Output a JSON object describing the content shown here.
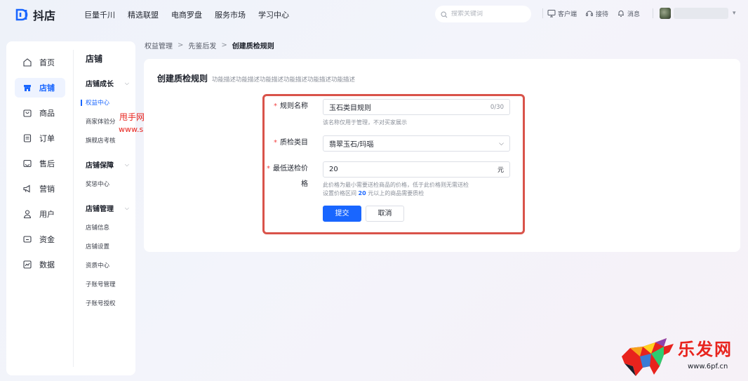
{
  "app": {
    "name": "抖店",
    "brand_color": "#1966ff"
  },
  "topnav": [
    "巨量千川",
    "精选联盟",
    "电商罗盘",
    "服务市场",
    "学习中心"
  ],
  "search": {
    "placeholder": "搜索关键词",
    "icon": "search-icon"
  },
  "top_actions": [
    {
      "label": "客户端",
      "icon": "monitor-icon"
    },
    {
      "label": "接待",
      "icon": "headset-icon"
    },
    {
      "label": "消息",
      "icon": "bell-icon"
    }
  ],
  "sidebar": {
    "items": [
      {
        "label": "首页",
        "icon": "home-icon",
        "active": false
      },
      {
        "label": "店铺",
        "icon": "store-icon",
        "active": true
      },
      {
        "label": "商品",
        "icon": "bag-icon",
        "active": false
      },
      {
        "label": "订单",
        "icon": "order-icon",
        "active": false
      },
      {
        "label": "售后",
        "icon": "aftersale-icon",
        "active": false
      },
      {
        "label": "营销",
        "icon": "megaphone-icon",
        "active": false
      },
      {
        "label": "用户",
        "icon": "user-icon",
        "active": false
      },
      {
        "label": "资金",
        "icon": "wallet-icon",
        "active": false
      },
      {
        "label": "数据",
        "icon": "chart-icon",
        "active": false
      }
    ]
  },
  "subnav": {
    "title": "店铺",
    "groups": [
      {
        "title": "店铺成长",
        "items": [
          "权益中心",
          "商家体验分",
          "旗舰店考核"
        ],
        "active_index": 0
      },
      {
        "title": "店铺保障",
        "items": [
          "奖惩中心"
        ]
      },
      {
        "title": "店铺管理",
        "items": [
          "店铺信息",
          "店铺设置",
          "资质中心",
          "子账号管理",
          "子账号授权"
        ]
      }
    ]
  },
  "watermark": {
    "site_name": "甩手网",
    "site_url": "www.shuaishou.com",
    "brand_name": "乐发网",
    "brand_url": "www.6pf.cn"
  },
  "breadcrumb": [
    "权益管理",
    "先鉴后发",
    "创建质检规则"
  ],
  "form": {
    "title": "创建质检规则",
    "description": "功能描述功能描述功能描述功能描述功能描述功能描述",
    "rule_name": {
      "label": "规则名称",
      "value": "玉石类目规则",
      "counter": "0/30",
      "hint": "该名称仅用于管理，不对买家展示"
    },
    "category": {
      "label": "质检类目",
      "value": "翡翠玉石/玛瑙"
    },
    "min_price": {
      "label": "最低送检价格",
      "value": "20",
      "unit": "元",
      "hint_line1": "此价格为最小需要送检商品的价格，低于此价格则无需送检",
      "hint_pre": "设置价格区间",
      "hint_value": "20",
      "hint_post": "元以上的商品需要质检"
    },
    "submit_label": "提交",
    "cancel_label": "取消"
  }
}
